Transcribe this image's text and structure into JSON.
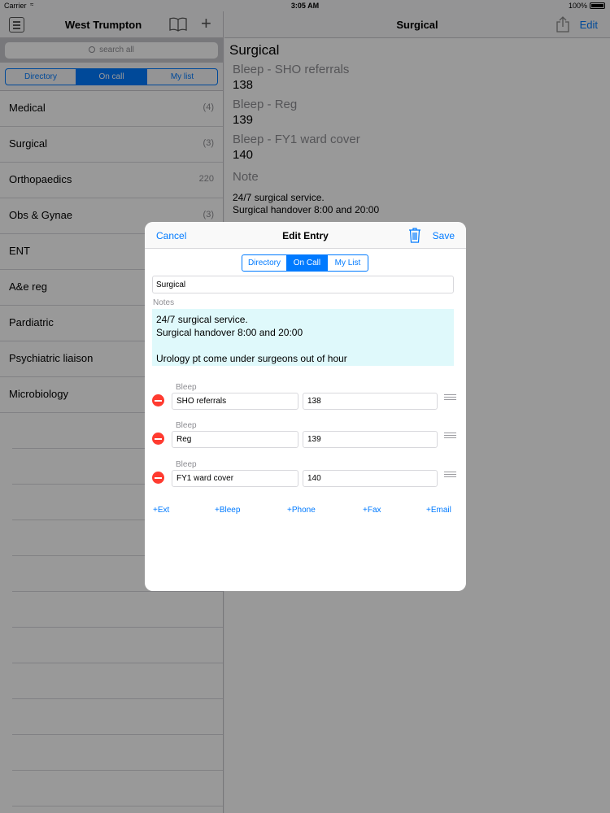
{
  "status_bar": {
    "carrier": "Carrier",
    "time": "3:05 AM",
    "battery": "100%"
  },
  "master": {
    "title": "West Trumpton",
    "search_placeholder": "search all",
    "segments": [
      "Directory",
      "On call",
      "My list"
    ],
    "selected_segment": 1,
    "items": [
      {
        "label": "Medical",
        "count": "(4)"
      },
      {
        "label": "Surgical",
        "count": "(3)"
      },
      {
        "label": "Orthopaedics",
        "count": "220"
      },
      {
        "label": "Obs & Gynae",
        "count": "(3)"
      },
      {
        "label": "ENT",
        "count": ""
      },
      {
        "label": "A&e reg",
        "count": ""
      },
      {
        "label": "Pardiatric",
        "count": ""
      },
      {
        "label": "Psychiatric liaison",
        "count": ""
      },
      {
        "label": "Microbiology",
        "count": ""
      }
    ]
  },
  "detail": {
    "nav_title": "Surgical",
    "edit_label": "Edit",
    "heading": "Surgical",
    "entries": [
      {
        "label": "Bleep - SHO referrals",
        "value": "138"
      },
      {
        "label": "Bleep - Reg",
        "value": "139"
      },
      {
        "label": "Bleep - FY1 ward cover",
        "value": "140"
      }
    ],
    "note_label": "Note",
    "note_lines": [
      "24/7 surgical service.",
      "Surgical handover 8:00 and 20:00"
    ]
  },
  "modal": {
    "cancel_label": "Cancel",
    "title": "Edit Entry",
    "save_label": "Save",
    "segments": [
      "Directory",
      "On Call",
      "My List"
    ],
    "selected_segment": 1,
    "name_value": "Surgical",
    "notes_label": "Notes",
    "notes_value": "24/7 surgical service.\nSurgical handover 8:00 and 20:00\n\nUrology pt come under surgeons out of hour",
    "rows": [
      {
        "type": "Bleep",
        "label": "SHO referrals",
        "number": "138"
      },
      {
        "type": "Bleep",
        "label": "Reg",
        "number": "139"
      },
      {
        "type": "Bleep",
        "label": "FY1 ward cover",
        "number": "140"
      }
    ],
    "actions": {
      "ext": "+Ext",
      "bleep": "+Bleep",
      "phone": "+Phone",
      "fax": "+Fax",
      "email": "+Email"
    }
  },
  "colors": {
    "accent": "#007aff",
    "delete": "#ff3b30",
    "notes_bg": "#dff9fb"
  }
}
